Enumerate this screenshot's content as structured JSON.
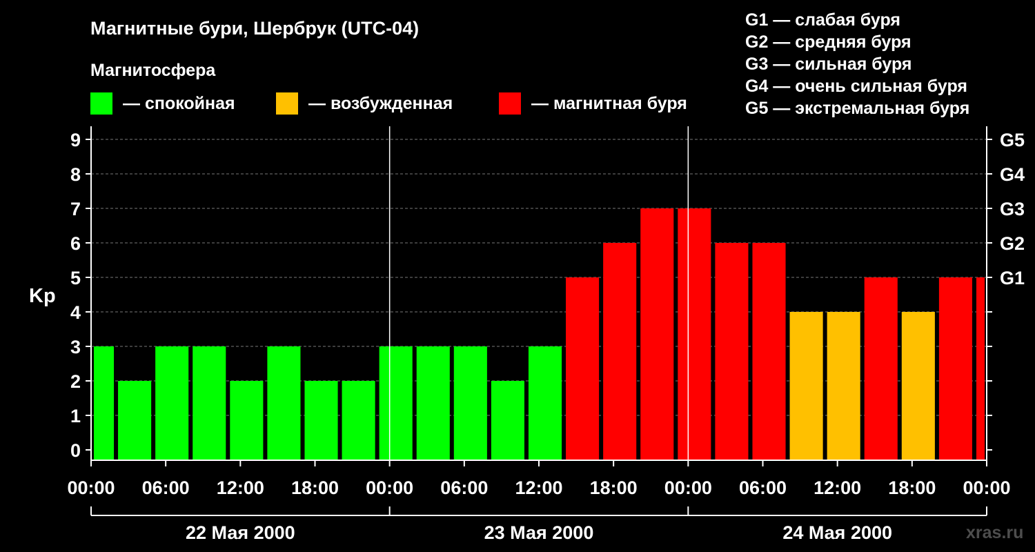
{
  "chart_data": {
    "type": "bar",
    "title": "Магнитные бури, Шербрук (UTC-04)",
    "legend": {
      "title": "Магнитосфера",
      "items": [
        {
          "key": "quiet",
          "label": "— спокойная",
          "color": "#00ff00"
        },
        {
          "key": "active",
          "label": "— возбужденная",
          "color": "#ffc000"
        },
        {
          "key": "storm",
          "label": "— магнитная буря",
          "color": "#ff0000"
        }
      ]
    },
    "storm_scale": [
      "G1 — слабая буря",
      "G2 — средняя буря",
      "G3 — сильная буря",
      "G4 — очень сильная буря",
      "G5 — экстремальная буря"
    ],
    "ylabel": "Kp",
    "ylim": [
      0,
      9
    ],
    "yticks": [
      "0",
      "1",
      "2",
      "3",
      "4",
      "5",
      "6",
      "7",
      "8",
      "9"
    ],
    "right_ticks": [
      {
        "value": 5,
        "label": "G1"
      },
      {
        "value": 6,
        "label": "G2"
      },
      {
        "value": 7,
        "label": "G3"
      },
      {
        "value": 8,
        "label": "G4"
      },
      {
        "value": 9,
        "label": "G5"
      }
    ],
    "xticks": [
      "00:00",
      "06:00",
      "12:00",
      "18:00",
      "00:00",
      "06:00",
      "12:00",
      "18:00",
      "00:00",
      "06:00",
      "12:00",
      "18:00",
      "00:00"
    ],
    "days": [
      "22 Мая 2000",
      "23 Мая 2000",
      "24 Мая 2000"
    ],
    "hours_total": 72,
    "grid": "horizontal dashed",
    "bars": [
      {
        "start": "22 Мая 2000 00:00",
        "end": "22 Мая 2000 02:00",
        "kp": 3,
        "level": "quiet"
      },
      {
        "start": "22 Мая 2000 02:00",
        "end": "22 Мая 2000 05:00",
        "kp": 2,
        "level": "quiet"
      },
      {
        "start": "22 Мая 2000 05:00",
        "end": "22 Мая 2000 08:00",
        "kp": 3,
        "level": "quiet"
      },
      {
        "start": "22 Мая 2000 08:00",
        "end": "22 Мая 2000 11:00",
        "kp": 3,
        "level": "quiet"
      },
      {
        "start": "22 Мая 2000 11:00",
        "end": "22 Мая 2000 14:00",
        "kp": 2,
        "level": "quiet"
      },
      {
        "start": "22 Мая 2000 14:00",
        "end": "22 Мая 2000 17:00",
        "kp": 3,
        "level": "quiet"
      },
      {
        "start": "22 Мая 2000 17:00",
        "end": "22 Мая 2000 20:00",
        "kp": 2,
        "level": "quiet"
      },
      {
        "start": "22 Мая 2000 20:00",
        "end": "22 Мая 2000 23:00",
        "kp": 2,
        "level": "quiet"
      },
      {
        "start": "22 Мая 2000 23:00",
        "end": "23 Мая 2000 02:00",
        "kp": 3,
        "level": "quiet"
      },
      {
        "start": "23 Мая 2000 02:00",
        "end": "23 Мая 2000 05:00",
        "kp": 3,
        "level": "quiet"
      },
      {
        "start": "23 Мая 2000 05:00",
        "end": "23 Мая 2000 08:00",
        "kp": 3,
        "level": "quiet"
      },
      {
        "start": "23 Мая 2000 08:00",
        "end": "23 Мая 2000 11:00",
        "kp": 2,
        "level": "quiet"
      },
      {
        "start": "23 Мая 2000 11:00",
        "end": "23 Мая 2000 14:00",
        "kp": 3,
        "level": "quiet"
      },
      {
        "start": "23 Мая 2000 14:00",
        "end": "23 Мая 2000 17:00",
        "kp": 5,
        "level": "storm"
      },
      {
        "start": "23 Мая 2000 17:00",
        "end": "23 Мая 2000 20:00",
        "kp": 6,
        "level": "storm"
      },
      {
        "start": "23 Мая 2000 20:00",
        "end": "23 Мая 2000 23:00",
        "kp": 7,
        "level": "storm"
      },
      {
        "start": "23 Мая 2000 23:00",
        "end": "24 Мая 2000 02:00",
        "kp": 7,
        "level": "storm"
      },
      {
        "start": "24 Мая 2000 02:00",
        "end": "24 Мая 2000 05:00",
        "kp": 6,
        "level": "storm"
      },
      {
        "start": "24 Мая 2000 05:00",
        "end": "24 Мая 2000 08:00",
        "kp": 6,
        "level": "storm"
      },
      {
        "start": "24 Мая 2000 08:00",
        "end": "24 Мая 2000 11:00",
        "kp": 4,
        "level": "active"
      },
      {
        "start": "24 Мая 2000 11:00",
        "end": "24 Мая 2000 14:00",
        "kp": 4,
        "level": "active"
      },
      {
        "start": "24 Мая 2000 14:00",
        "end": "24 Мая 2000 17:00",
        "kp": 5,
        "level": "storm"
      },
      {
        "start": "24 Мая 2000 17:00",
        "end": "24 Мая 2000 20:00",
        "kp": 4,
        "level": "active"
      },
      {
        "start": "24 Мая 2000 20:00",
        "end": "24 Мая 2000 23:00",
        "kp": 5,
        "level": "storm"
      },
      {
        "start": "24 Мая 2000 23:00",
        "end": "25 Мая 2000 00:00",
        "kp": 5,
        "level": "storm"
      }
    ]
  },
  "watermark": "xras.ru"
}
